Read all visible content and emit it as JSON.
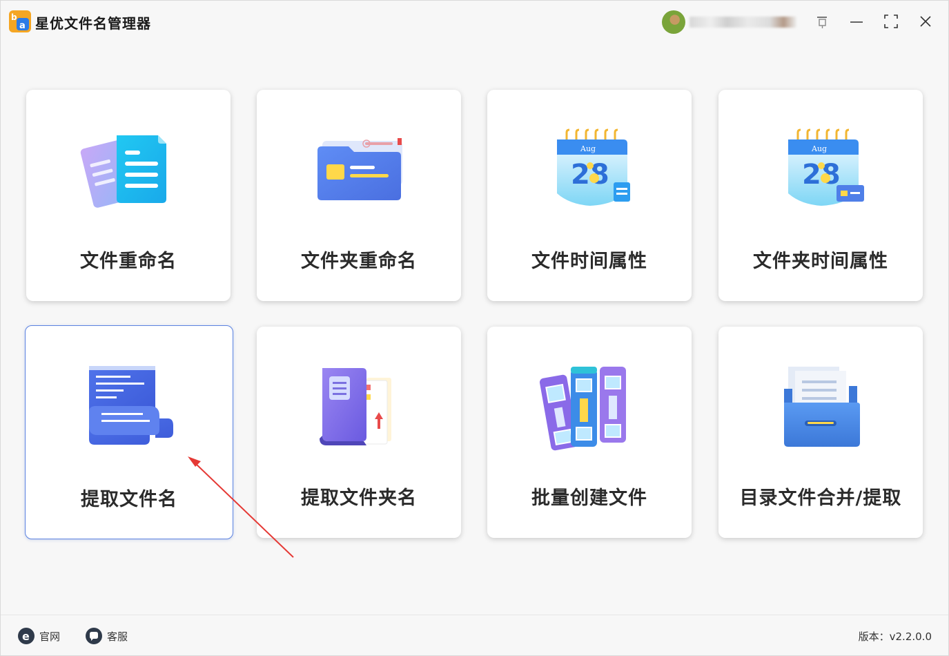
{
  "app": {
    "title": "星优文件名管理器",
    "logo_letters": [
      "b",
      "a"
    ]
  },
  "titlebar": {
    "icons": [
      "pin-icon",
      "minimize-icon",
      "maximize-icon",
      "close-icon"
    ]
  },
  "cards": [
    {
      "label": "文件重命名",
      "icon": "file-rename-icon"
    },
    {
      "label": "文件夹重命名",
      "icon": "folder-rename-icon"
    },
    {
      "label": "文件时间属性",
      "icon": "file-time-calendar-icon"
    },
    {
      "label": "文件夹时间属性",
      "icon": "folder-time-calendar-icon"
    },
    {
      "label": "提取文件名",
      "icon": "extract-filename-icon",
      "selected": true
    },
    {
      "label": "提取文件夹名",
      "icon": "extract-foldername-icon"
    },
    {
      "label": "批量创建文件",
      "icon": "batch-create-binders-icon"
    },
    {
      "label": "目录文件合并/提取",
      "icon": "directory-merge-drawer-icon"
    }
  ],
  "calendar": {
    "month": "Aug",
    "day": "28"
  },
  "footer": {
    "website_label": "官网",
    "support_label": "客服",
    "version_text": "版本：v2.2.0.0"
  },
  "colors": {
    "accent": "#5b82e0",
    "logo_orange": "#f5a623",
    "logo_blue": "#2d7be6",
    "annotation_arrow": "#e53935"
  }
}
